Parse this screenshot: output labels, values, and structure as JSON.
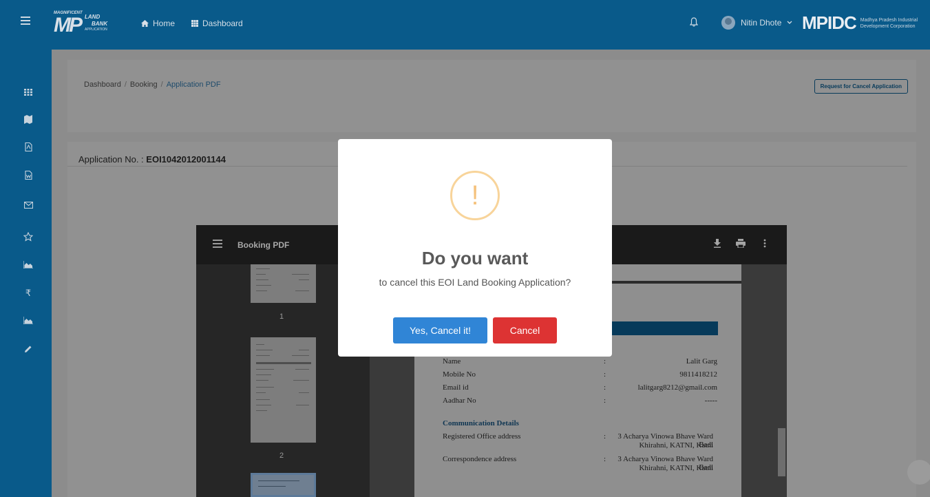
{
  "topbar": {
    "logo_magnificent": "MAGNIFICENT",
    "logo_mp": "MP",
    "logo_land": "LAND",
    "logo_bank": "BANK",
    "logo_application": "APPLICATION",
    "home_label": "Home",
    "dashboard_label": "Dashboard",
    "user_name": "Nitin Dhote",
    "org_line1": "Madhya Pradesh Industrial",
    "org_line2": "Development Corporation",
    "org_logo_text": "MPIDC"
  },
  "sidebar": {
    "items": [
      "dashboard-icon",
      "map-icon",
      "pdf-icon",
      "word-icon",
      "mail-icon",
      "star-icon",
      "chart-icon",
      "rupee-icon",
      "chart-icon",
      "pencil-icon"
    ]
  },
  "breadcrumb": {
    "items": [
      "Dashboard",
      "Booking",
      "Application PDF"
    ],
    "separator": "/"
  },
  "request_cancel_label": "Request for Cancel Application",
  "application": {
    "label": "Application No. : ",
    "number": "EOI1042012001144"
  },
  "pdf_viewer": {
    "title": "Booking PDF",
    "thumb_numbers": [
      "1",
      "2"
    ],
    "fields": [
      {
        "label": "Name",
        "sep": ":",
        "value": "Lalit Garg"
      },
      {
        "label": "Mobile No",
        "sep": ":",
        "value": "9811418212"
      },
      {
        "label": "Email id",
        "sep": ":",
        "value": "lalitgarg8212@gmail.com"
      },
      {
        "label": "Aadhar No",
        "sep": ":",
        "value": "-----"
      }
    ],
    "section_title": "Communication Details",
    "addresses": [
      {
        "label": "Registered Office address",
        "sep": ":",
        "line1": "3 Acharya Vinowa Bhave Ward Badi",
        "line2": "Khirahni, KATNI, Katni"
      },
      {
        "label": "Correspondence address",
        "sep": ":",
        "line1": "3 Acharya Vinowa Bhave Ward Badi",
        "line2": "Khirahni, KATNI, Katni"
      }
    ]
  },
  "modal": {
    "icon_glyph": "!",
    "title": "Do you want",
    "text": "to cancel this EOI Land Booking Application?",
    "confirm_label": "Yes, Cancel it!",
    "cancel_label": "Cancel"
  },
  "colors": {
    "brand": "#095a8a",
    "confirm": "#3085d6",
    "cancel": "#dd3333",
    "warning": "#f8d49a"
  }
}
